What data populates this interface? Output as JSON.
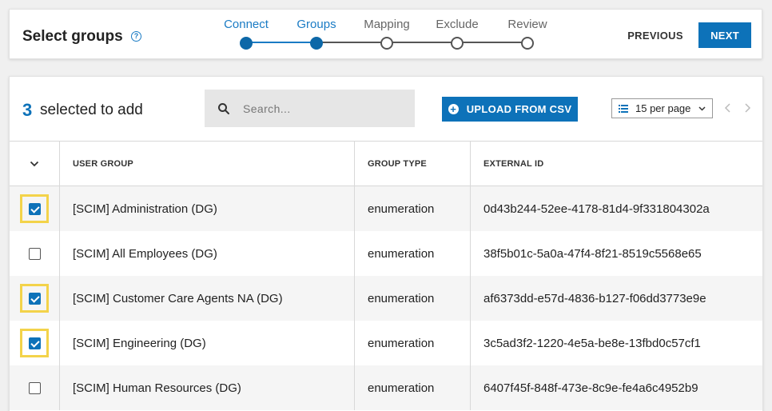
{
  "header": {
    "title": "Select groups",
    "help_glyph": "?",
    "steps": [
      {
        "label": "Connect",
        "state": "done"
      },
      {
        "label": "Groups",
        "state": "active"
      },
      {
        "label": "Mapping",
        "state": "pending"
      },
      {
        "label": "Exclude",
        "state": "pending"
      },
      {
        "label": "Review",
        "state": "pending"
      }
    ],
    "previous_label": "PREVIOUS",
    "next_label": "NEXT"
  },
  "toolbar": {
    "selected_count": "3",
    "selected_text": "selected to add",
    "search_placeholder": "Search...",
    "upload_label": "UPLOAD FROM CSV",
    "per_page": "15 per page"
  },
  "table": {
    "columns": [
      "USER GROUP",
      "GROUP TYPE",
      "EXTERNAL ID"
    ],
    "rows": [
      {
        "checked": true,
        "group": "[SCIM] Administration (DG)",
        "type": "enumeration",
        "id": "0d43b244-52ee-4178-81d4-9f331804302a"
      },
      {
        "checked": false,
        "group": "[SCIM] All Employees (DG)",
        "type": "enumeration",
        "id": "38f5b01c-5a0a-47f4-8f21-8519c5568e65"
      },
      {
        "checked": true,
        "group": "[SCIM] Customer Care Agents NA (DG)",
        "type": "enumeration",
        "id": "af6373dd-e57d-4836-b127-f06dd3773e9e"
      },
      {
        "checked": true,
        "group": "[SCIM] Engineering (DG)",
        "type": "enumeration",
        "id": "3c5ad3f2-1220-4e5a-be8e-13fbd0c57cf1"
      },
      {
        "checked": false,
        "group": "[SCIM] Human Resources (DG)",
        "type": "enumeration",
        "id": "6407f45f-848f-473e-8c9e-fe4a6c4952b9"
      }
    ]
  },
  "colors": {
    "accent": "#0d72b9",
    "highlight": "#f3d34a"
  }
}
